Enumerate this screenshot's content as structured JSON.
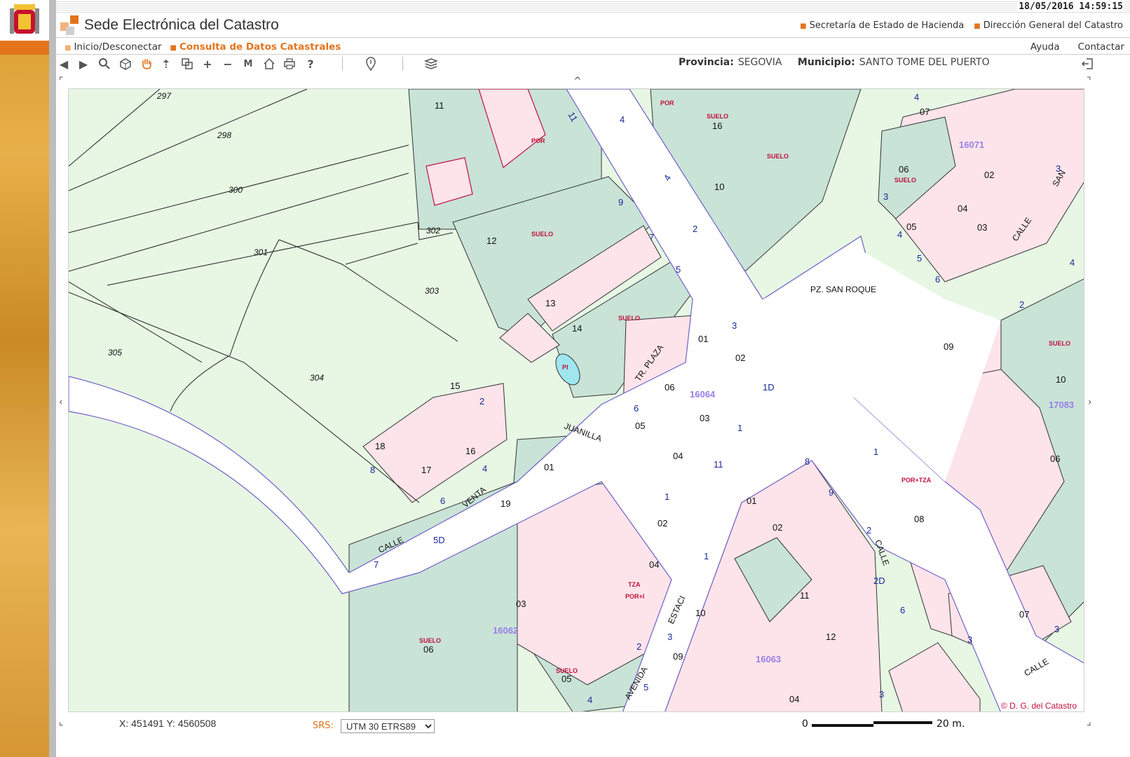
{
  "datetime": "18/05/2016 14:59:15",
  "site_title": "Sede Electrónica del Catastro",
  "header_links": [
    "Secretaría de Estado de Hacienda",
    "Dirección General del Catastro"
  ],
  "nav": {
    "home": "Inicio/Desconectar",
    "active": "Consulta de Datos Catastrales",
    "help": "Ayuda",
    "contact": "Contactar"
  },
  "toolbar": {
    "icons": [
      "back-icon",
      "forward-icon",
      "zoom-icon",
      "3d-icon",
      "pan-hand-icon",
      "upload-icon",
      "window-zoom-icon",
      "zoom-in-icon",
      "zoom-out-icon",
      "measure-icon",
      "home-icon",
      "print-icon",
      "help-icon",
      "info-icon",
      "layers-icon"
    ],
    "province_label": "Provincia:",
    "province": "SEGOVIA",
    "municipality_label": "Municipio:",
    "municipality": "SANTO TOME DEL PUERTO"
  },
  "status": {
    "coords": "X: 451491 Y: 4560508",
    "srs_label": "SRS:",
    "srs_value": "UTM 30 ETRS89",
    "scale_zero": "0",
    "scale_max": "20 m."
  },
  "map": {
    "copyright": "© D. G. del Catastro",
    "colors": {
      "rustic": "#e7f7e4",
      "built": "#fde4ea",
      "lot": "#c9e3d7",
      "boundary": "#7060c8",
      "road": "#ffffff",
      "block_label": "#9a7fe6",
      "use_label": "#c0103c"
    },
    "parcels": [
      "297",
      "298",
      "300",
      "301",
      "302",
      "303",
      "304",
      "305",
      "11",
      "12",
      "13",
      "14",
      "15",
      "16",
      "17",
      "18",
      "19",
      "01",
      "02",
      "03",
      "04",
      "05",
      "06",
      "07",
      "08",
      "09",
      "10"
    ],
    "block_ids": [
      "16071",
      "16064",
      "16062",
      "16063",
      "17083"
    ],
    "streets": [
      "PZ. SAN ROQUE",
      "TR. PLAZA",
      "JUANILLA",
      "VENTA",
      "CALLE",
      "AVENIDA",
      "ESTACI"
    ],
    "use_labels": [
      "SUELO",
      "POR",
      "POR+TZA",
      "TZA",
      "PI"
    ]
  }
}
